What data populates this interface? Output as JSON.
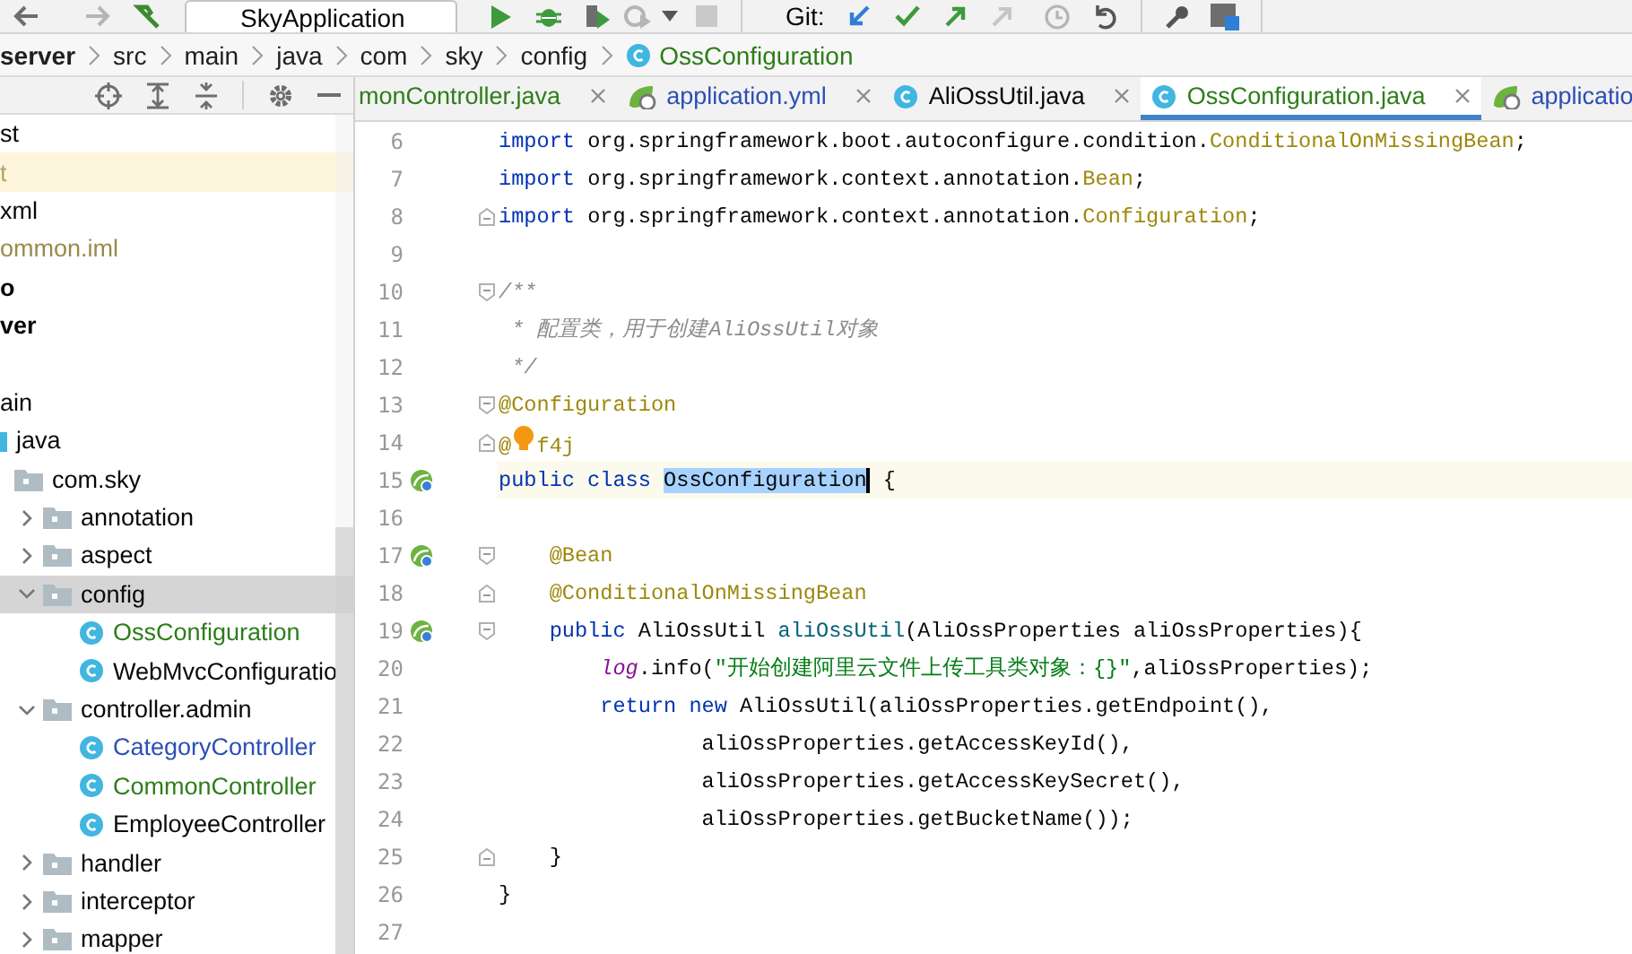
{
  "toolbar": {
    "run_configuration": "SkyApplication",
    "vcs_label": "Git:"
  },
  "breadcrumb": {
    "items": [
      "server",
      "src",
      "main",
      "java",
      "com",
      "sky",
      "config"
    ],
    "current": "OssConfiguration"
  },
  "project_panel": {
    "tree": [
      {
        "label": "st",
        "kind": "text",
        "color": "#080808",
        "selected": false,
        "marked": false
      },
      {
        "label": "t",
        "kind": "text",
        "color": "#b3a56b",
        "selected": false,
        "marked": true
      },
      {
        "label": "xml",
        "kind": "text",
        "color": "#080808",
        "selected": false,
        "marked": false
      },
      {
        "label": "ommon.iml",
        "kind": "text",
        "color": "#9a8a4a",
        "selected": false,
        "marked": false
      },
      {
        "label": "o",
        "kind": "module",
        "color": "#080808",
        "selected": false,
        "marked": false
      },
      {
        "label": "ver",
        "kind": "module",
        "color": "#080808",
        "selected": false,
        "marked": false
      },
      {
        "kind": "blank",
        "selected": false,
        "marked": false
      },
      {
        "label": "ain",
        "kind": "text",
        "color": "#080808",
        "selected": false,
        "marked": false
      },
      {
        "label": "java",
        "kind": "source-root",
        "color": "#080808",
        "selected": false,
        "marked": false,
        "children": [
          {
            "label": "com.sky",
            "kind": "package",
            "color": "#080808",
            "selected": false,
            "marked": false,
            "children": [
              {
                "label": "annotation",
                "kind": "package",
                "color": "#080808",
                "expanded": false,
                "selected": false,
                "marked": false
              },
              {
                "label": "aspect",
                "kind": "package",
                "color": "#080808",
                "expanded": false,
                "selected": false,
                "marked": false
              },
              {
                "label": "config",
                "kind": "package",
                "color": "#080808",
                "expanded": true,
                "selected": true,
                "marked": false,
                "children": [
                  {
                    "label": "OssConfiguration",
                    "kind": "class",
                    "color": "#2d7d1a",
                    "selected": false,
                    "marked": false
                  },
                  {
                    "label": "WebMvcConfiguratio",
                    "kind": "class",
                    "color": "#080808",
                    "selected": false,
                    "marked": false
                  }
                ]
              },
              {
                "label": "controller.admin",
                "kind": "package",
                "color": "#080808",
                "expanded": true,
                "selected": false,
                "marked": false,
                "children": [
                  {
                    "label": "CategoryController",
                    "kind": "class",
                    "color": "#2b4fb5",
                    "selected": false,
                    "marked": false
                  },
                  {
                    "label": "CommonController",
                    "kind": "class",
                    "color": "#2d7d1a",
                    "selected": false,
                    "marked": false
                  },
                  {
                    "label": "EmployeeController",
                    "kind": "class",
                    "color": "#080808",
                    "selected": false,
                    "marked": false
                  }
                ]
              },
              {
                "label": "handler",
                "kind": "package",
                "color": "#080808",
                "expanded": false,
                "selected": false,
                "marked": false
              },
              {
                "label": "interceptor",
                "kind": "package",
                "color": "#080808",
                "expanded": false,
                "selected": false,
                "marked": false
              },
              {
                "label": "mapper",
                "kind": "package",
                "color": "#080808",
                "expanded": false,
                "selected": false,
                "marked": false
              }
            ]
          }
        ]
      }
    ]
  },
  "editor": {
    "tabs": [
      {
        "label": "monController.java",
        "kind": "plain",
        "color": "#2d7d1a",
        "selected": false
      },
      {
        "label": "application.yml",
        "kind": "yaml",
        "color": "#2b4fb5",
        "selected": false
      },
      {
        "label": "AliOssUtil.java",
        "kind": "class",
        "color": "#080808",
        "selected": false
      },
      {
        "label": "OssConfiguration.java",
        "kind": "class",
        "color": "#2d7d1a",
        "selected": true
      },
      {
        "label": "applicatio",
        "kind": "yaml",
        "color": "#2b4fb5",
        "selected": false
      }
    ],
    "lines": [
      {
        "number": "6",
        "current": false,
        "segments": [
          {
            "kind": "keyword",
            "text": "import"
          },
          {
            "kind": "plain",
            "text": " org.springframework.boot.autoconfigure.condition."
          },
          {
            "kind": "annotation",
            "text": "ConditionalOnMissingBean"
          },
          {
            "kind": "plain",
            "text": ";"
          }
        ]
      },
      {
        "number": "7",
        "current": false,
        "segments": [
          {
            "kind": "keyword",
            "text": "import"
          },
          {
            "kind": "plain",
            "text": " org.springframework.context.annotation."
          },
          {
            "kind": "annotation",
            "text": "Bean"
          },
          {
            "kind": "plain",
            "text": ";"
          }
        ]
      },
      {
        "number": "8",
        "current": false,
        "fold": {
          "kind": "end"
        },
        "segments": [
          {
            "kind": "keyword",
            "text": "import"
          },
          {
            "kind": "plain",
            "text": " org.springframework.context.annotation."
          },
          {
            "kind": "annotation",
            "text": "Configuration"
          },
          {
            "kind": "plain",
            "text": ";"
          }
        ]
      },
      {
        "number": "9",
        "current": false
      },
      {
        "number": "10",
        "current": false,
        "fold": {
          "kind": "start"
        },
        "segments": [
          {
            "kind": "comment",
            "text": "/**"
          }
        ]
      },
      {
        "number": "11",
        "current": false,
        "segments": [
          {
            "kind": "comment",
            "text": " * 配置类，用于创建AliOssUtil对象"
          }
        ]
      },
      {
        "number": "12",
        "current": false,
        "segments": [
          {
            "kind": "comment",
            "text": " */"
          }
        ]
      },
      {
        "number": "13",
        "current": false,
        "fold": {
          "kind": "start"
        },
        "segments": [
          {
            "kind": "annotation",
            "text": "@Configuration"
          }
        ]
      },
      {
        "number": "14",
        "current": false,
        "fold": {
          "kind": "end"
        },
        "segments": [
          {
            "kind": "annotation",
            "text": "@"
          },
          {
            "kind": "bulb"
          },
          {
            "kind": "annotation",
            "text": "f4j"
          }
        ]
      },
      {
        "number": "15",
        "current": true,
        "marker": {
          "kind": "bean"
        },
        "segments": [
          {
            "kind": "keyword",
            "text": "public class "
          },
          {
            "kind": "selection",
            "text": "OssConfiguration"
          },
          {
            "kind": "plain",
            "text": " {"
          }
        ]
      },
      {
        "number": "16",
        "current": false
      },
      {
        "number": "17",
        "current": false,
        "marker": {
          "kind": "bean"
        },
        "fold": {
          "kind": "start"
        },
        "segments": [
          {
            "kind": "annotation",
            "text": "    @Bean"
          }
        ]
      },
      {
        "number": "18",
        "current": false,
        "fold": {
          "kind": "end"
        },
        "segments": [
          {
            "kind": "annotation",
            "text": "    @ConditionalOnMissingBean"
          }
        ]
      },
      {
        "number": "19",
        "current": false,
        "marker": {
          "kind": "bean"
        },
        "fold": {
          "kind": "start"
        },
        "segments": [
          {
            "kind": "keyword",
            "text": "    public"
          },
          {
            "kind": "plain",
            "text": " AliOssUtil "
          },
          {
            "kind": "method",
            "text": "aliOssUtil"
          },
          {
            "kind": "plain",
            "text": "(AliOssProperties aliOssProperties){"
          }
        ]
      },
      {
        "number": "20",
        "current": false,
        "segments": [
          {
            "kind": "field",
            "text": "        log"
          },
          {
            "kind": "plain",
            "text": ".info("
          },
          {
            "kind": "string",
            "text": "\"开始创建阿里云文件上传工具类对象：{}\""
          },
          {
            "kind": "plain",
            "text": ",aliOssProperties);"
          }
        ]
      },
      {
        "number": "21",
        "current": false,
        "segments": [
          {
            "kind": "keyword",
            "text": "        return new"
          },
          {
            "kind": "plain",
            "text": " AliOssUtil(aliOssProperties.getEndpoint(),"
          }
        ]
      },
      {
        "number": "22",
        "current": false,
        "segments": [
          {
            "kind": "plain",
            "text": "                aliOssProperties.getAccessKeyId(),"
          }
        ]
      },
      {
        "number": "23",
        "current": false,
        "segments": [
          {
            "kind": "plain",
            "text": "                aliOssProperties.getAccessKeySecret(),"
          }
        ]
      },
      {
        "number": "24",
        "current": false,
        "segments": [
          {
            "kind": "plain",
            "text": "                aliOssProperties.getBucketName());"
          }
        ]
      },
      {
        "number": "25",
        "current": false,
        "fold": {
          "kind": "end"
        },
        "segments": [
          {
            "kind": "plain",
            "text": "    }"
          }
        ]
      },
      {
        "number": "26",
        "current": false,
        "segments": [
          {
            "kind": "plain",
            "text": "}"
          }
        ]
      },
      {
        "number": "27",
        "current": false
      }
    ]
  }
}
